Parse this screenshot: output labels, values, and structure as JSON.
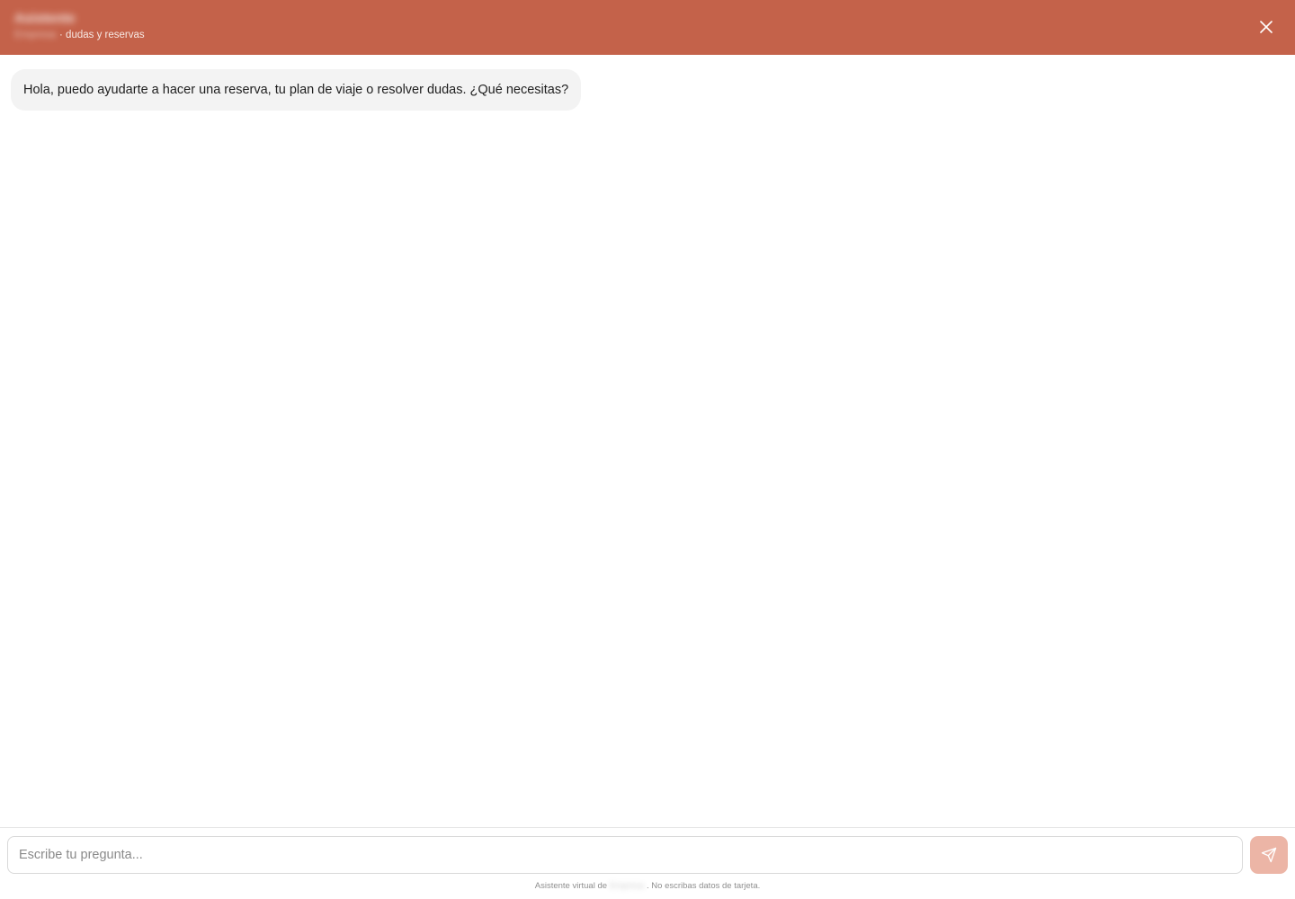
{
  "header": {
    "brand_name": "Asistente",
    "subtitle_blurred": "Empresa",
    "subtitle": "· dudas y reservas",
    "close_icon": "close-icon",
    "background_color": "#c4624a"
  },
  "messages": [
    {
      "role": "assistant",
      "text": "Hola, puedo ayudarte a hacer una reserva, tu plan de viaje o resolver dudas. ¿Qué necesitas?"
    }
  ],
  "composer": {
    "placeholder": "Escribe tu pregunta...",
    "value": "",
    "send_icon": "send-icon",
    "send_button_color": "#ecb5a6"
  },
  "footer": {
    "disclaimer_prefix": "Asistente virtual de",
    "disclaimer_blurred": "Empresa",
    "disclaimer_suffix": ". No escribas datos de tarjeta."
  }
}
